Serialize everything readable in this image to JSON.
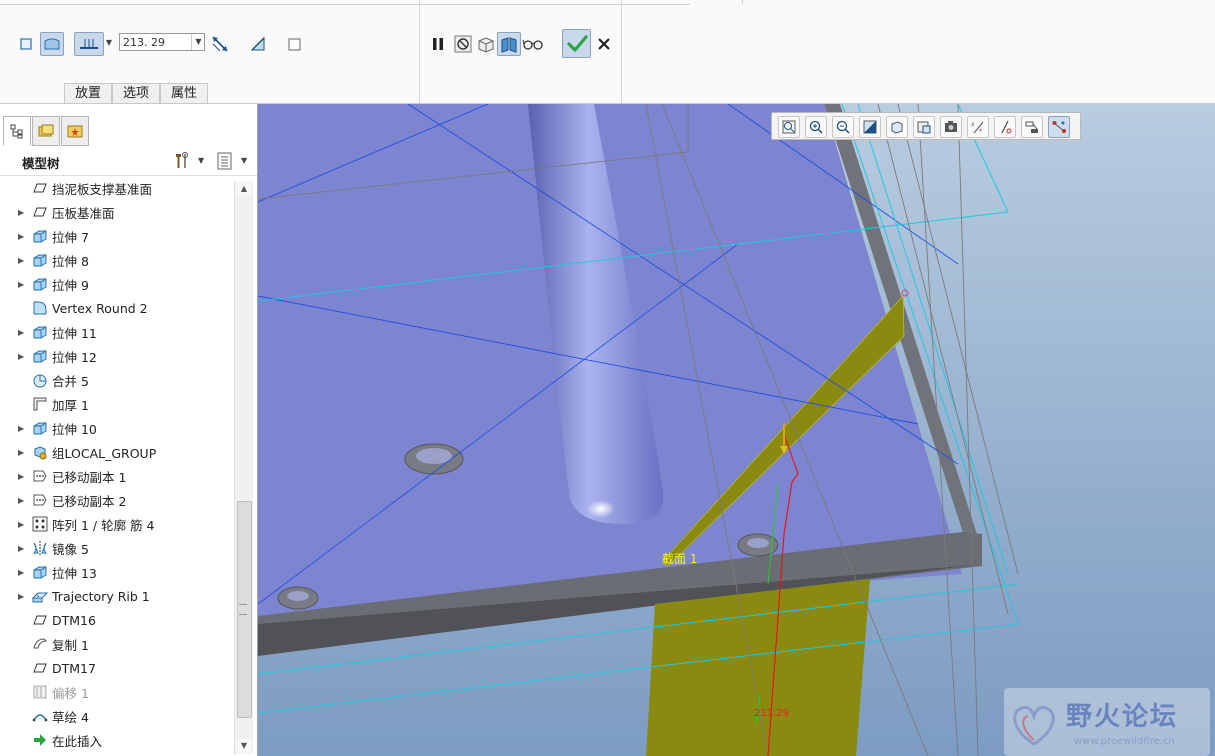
{
  "ribbon": {
    "dimension_value": "213. 29",
    "tabs": [
      "放置",
      "选项",
      "属性"
    ]
  },
  "model_tree": {
    "title": "模型树",
    "items": [
      {
        "label": "挡泥板支撑基准面",
        "icon": "datum-plane-icon",
        "expandable": false
      },
      {
        "label": "压板基准面",
        "icon": "datum-plane-icon",
        "expandable": true
      },
      {
        "label": "拉伸 7",
        "icon": "extrude-icon",
        "expandable": true
      },
      {
        "label": "拉伸 8",
        "icon": "extrude-icon",
        "expandable": true
      },
      {
        "label": "拉伸 9",
        "icon": "extrude-icon",
        "expandable": true
      },
      {
        "label": "Vertex Round 2",
        "icon": "round-icon",
        "expandable": false
      },
      {
        "label": "拉伸 11",
        "icon": "extrude-icon",
        "expandable": true
      },
      {
        "label": "拉伸 12",
        "icon": "extrude-icon",
        "expandable": true
      },
      {
        "label": "合并 5",
        "icon": "merge-icon",
        "expandable": false
      },
      {
        "label": "加厚 1",
        "icon": "thicken-icon",
        "expandable": false
      },
      {
        "label": "拉伸 10",
        "icon": "extrude-icon",
        "expandable": true
      },
      {
        "label": "组LOCAL_GROUP",
        "icon": "group-icon",
        "expandable": true
      },
      {
        "label": "已移动副本 1",
        "icon": "moved-copy-icon",
        "expandable": true
      },
      {
        "label": "已移动副本 2",
        "icon": "moved-copy-icon",
        "expandable": true
      },
      {
        "label": "阵列 1 / 轮廓 筋 4",
        "icon": "pattern-icon",
        "expandable": true
      },
      {
        "label": "镜像 5",
        "icon": "mirror-icon",
        "expandable": true
      },
      {
        "label": "拉伸 13",
        "icon": "extrude-icon",
        "expandable": true
      },
      {
        "label": "Trajectory Rib 1",
        "icon": "rib-icon",
        "expandable": true
      },
      {
        "label": "DTM16",
        "icon": "datum-plane-icon",
        "expandable": false
      },
      {
        "label": "复制 1",
        "icon": "copy-icon",
        "expandable": false
      },
      {
        "label": "DTM17",
        "icon": "datum-plane-icon",
        "expandable": false
      },
      {
        "label": "偏移 1",
        "icon": "offset-icon",
        "expandable": false,
        "dimmed": true
      },
      {
        "label": "草绘 4",
        "icon": "sketch-icon",
        "expandable": false
      },
      {
        "label": "在此插入",
        "icon": "insert-here-icon",
        "expandable": false
      }
    ]
  },
  "viewport": {
    "section_label": "截面 1",
    "dimension_label": "213.29",
    "watermark_title": "野火论坛",
    "watermark_url": "www.proewildfire.cn"
  },
  "colors": {
    "part_face": "#7d84d0",
    "part_edge": "#6a6d74",
    "rib": "#8a8a10",
    "datum": "#1f9fe0",
    "ok_green": "#2aa640"
  }
}
